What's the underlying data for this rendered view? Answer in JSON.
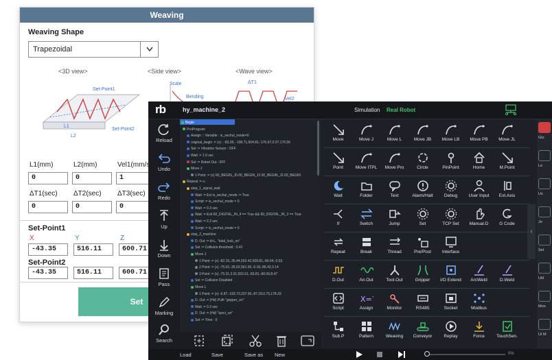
{
  "weaving": {
    "title": "Weaving",
    "shape_label": "Weaving Shape",
    "shape_value": "Trapezoidal",
    "views": {
      "view3d": "<3D view>",
      "side": "<Side view>",
      "wave": "<Wave view>"
    },
    "diagram_labels": {
      "sp1": "Set-Point1",
      "sp2": "Set-Point2",
      "l1": "L1",
      "l2": "L2",
      "scale": "Scale",
      "bending": "Bending",
      "t1": "ΔT1",
      "vel2": "Vel2"
    },
    "fields_row1": {
      "labels": [
        "L1(mm)",
        "L2(mm)",
        "Vel1(mm/s"
      ],
      "values": [
        "0",
        "0",
        "1"
      ]
    },
    "fields_row2": {
      "labels": [
        "ΔT1(sec)",
        "ΔT2(sec)",
        "ΔT3(sec)"
      ],
      "values": [
        "0",
        "0",
        "0"
      ]
    },
    "setpoint1": {
      "label": "Set-Point1",
      "x": "-43.35",
      "y": "516.11",
      "z": "600.71"
    },
    "setpoint2": {
      "label": "Set-Point2",
      "x": "-43.35",
      "y": "516.11",
      "z": "600.71"
    },
    "axes": {
      "x": "X",
      "y": "Y",
      "z": "Z"
    },
    "set_button": "Set"
  },
  "app": {
    "logo": "rb",
    "project": "hy_machine_2",
    "mode_sim": "Simulation",
    "mode_real": "Real Robot",
    "sidebar": [
      "Reload",
      "Undo",
      "Redo",
      "Up",
      "Down",
      "Pass",
      "Marking",
      "Search"
    ],
    "tree_rows": [
      "Begin",
      "ProProgram",
      "Assign :: Variable : is_sechul_mode=0",
      "original_begin := (x) : -83.00, -198.71,604.81,-176.67,0.07,176.56",
      "Set := Vibration Sensor : OFF",
      "Wait := 1.0 sec",
      "Set := Robot Out : 0FF",
      "Move J",
      "1 Point := (x) 60_BEGIN_J0.00_BEGIN_J2.00_BEGIN_J2.00_BEGIN",
      "Repeat := ∞",
      "step_1_signal_wait",
      "Wait := Ext is_sechul_mode := True",
      "Script := is_sechul_mode = 0",
      "Wait := 0.3 sec",
      "Wait := Exit 60_DIGITAL_IN_4 == True && 60_DIGITAL_IN_3 == True",
      "Wait := 0.2 sec",
      "Script := is_sechul_mode = 0",
      "step_2_machine",
      "D. Out := d+L, \"total_lock_on\"",
      "Set := Collision threshold : 0.42",
      "Move J",
      "1 Point := (x) -82.19,-35.44,550.42,609.81,-86.64,-0.53",
      "2 Point := (x) -75.02,-35.02,561.00,-0.18,-85.42,3.14",
      "3 Point := (x) -75.31,3.01,552.61,-83.81,-90.06,8.47",
      "Set := Collision Disabled",
      "Move L",
      "1 Point := (x) -6.87,-193.73,237.00,-87.29,0.75,178.33",
      "D. Out := (Hd) Pulh \"gripper_on\"",
      "Wait := 0.3 sec",
      "D. Out := (Hd) \"eject_on\"",
      "Set := Time : 0"
    ],
    "commands": [
      [
        "Move",
        "Move J",
        "Move L",
        "Move JB",
        "Move LB",
        "Move PB",
        "Move JL"
      ],
      [
        "Point",
        "Move ITPL",
        "Move Pro",
        "Circle",
        "PinPoint",
        "Home",
        "M.Point"
      ],
      [
        "Wait",
        "Folder",
        "Text",
        "Alarm/Halt",
        "Debug",
        "User Input",
        "Ext.Axis"
      ],
      [
        "If",
        "Switch",
        "Jump",
        "Set",
        "TCP Set",
        "Manual.D",
        "G Code"
      ],
      [
        "Repeat",
        "Break",
        "Thread",
        "Pre/Post",
        "Interface"
      ],
      [
        "D.Out",
        "An.Out",
        "Tool.Out",
        "Gripper",
        "I/O Extend",
        "ArcWeld",
        "D.Weld"
      ],
      [
        "Script",
        "Assign",
        "Monitor",
        "RS485",
        "Socket",
        "Modbus"
      ],
      [
        "Sub.P",
        "Pattern",
        "Weaving",
        "Conveyor",
        "Replay",
        "Force",
        "TouchSen."
      ]
    ],
    "right_panel": [
      "Glo",
      "Lo",
      "Us",
      "Jo",
      "Set",
      "Util",
      "Mon",
      "UI M"
    ],
    "bottom": {
      "load": "Load",
      "save": "Save",
      "saveas": "Save as",
      "new": "New",
      "pct": "0%"
    },
    "progress": 0
  }
}
